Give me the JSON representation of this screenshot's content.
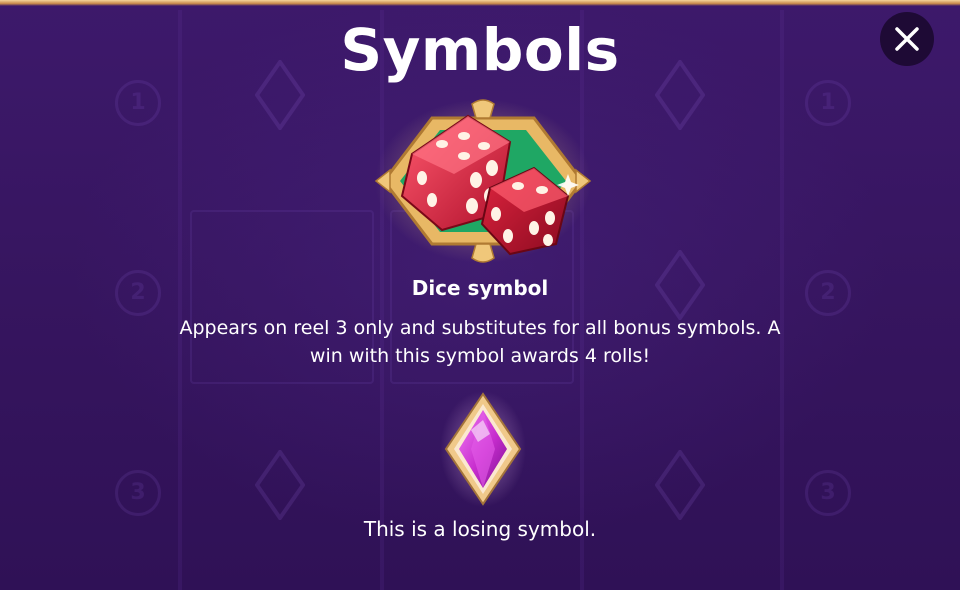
{
  "screen": {
    "title": "Symbols"
  },
  "close": {
    "icon": "close-icon"
  },
  "symbols": [
    {
      "icon": "dice-icon",
      "name": "Dice symbol",
      "description": "Appears on reel 3 only and substitutes for all bonus symbols. A win with this symbol awards 4 rolls!"
    },
    {
      "icon": "pink-diamond-gem-icon",
      "description": "This is a losing symbol."
    }
  ],
  "colors": {
    "background": "#3a1766",
    "title_text": "#ffffff",
    "close_button_bg": "#1e0a35",
    "dice_red": "#d8213f",
    "felt_green": "#1fa764",
    "gold_frame": "#e8b865",
    "gem_pink": "#d23bd9"
  }
}
